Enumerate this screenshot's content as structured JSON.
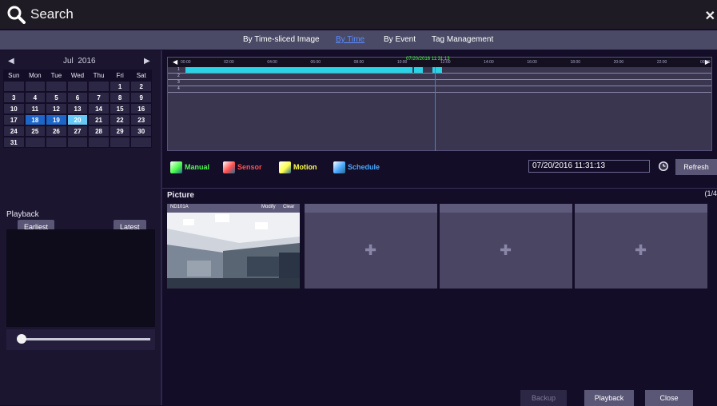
{
  "window": {
    "title": "Search",
    "close_icon": "close-icon"
  },
  "tabs": [
    {
      "label": "By Time-sliced Image",
      "active": false
    },
    {
      "label": "By Time",
      "active": true
    },
    {
      "label": "By Event",
      "active": false
    },
    {
      "label": "Tag Management",
      "active": false
    }
  ],
  "calendar": {
    "month": "Jul",
    "year": "2016",
    "weekdays": [
      "Sun",
      "Mon",
      "Tue",
      "Wed",
      "Thu",
      "Fri",
      "Sat"
    ],
    "weeks": [
      [
        "",
        "",
        "",
        "",
        "",
        "1",
        "2"
      ],
      [
        "3",
        "4",
        "5",
        "6",
        "7",
        "8",
        "9"
      ],
      [
        "10",
        "11",
        "12",
        "13",
        "14",
        "15",
        "16"
      ],
      [
        "17",
        "18",
        "19",
        "20",
        "21",
        "22",
        "23"
      ],
      [
        "24",
        "25",
        "26",
        "27",
        "28",
        "29",
        "30"
      ],
      [
        "31",
        "",
        "",
        "",
        "",
        "",
        ""
      ]
    ],
    "recorded_days": [
      "18",
      "19"
    ],
    "selected_day": "20",
    "earliest_label": "Earliest",
    "latest_label": "Latest"
  },
  "playback_panel": {
    "label": "Playback",
    "slider_position": 0.02
  },
  "timeline": {
    "cursor_time": "07/20/2016 11:31:13",
    "ticks": [
      "00:00",
      "02:00",
      "04:00",
      "06:00",
      "08:00",
      "10:00",
      "12:00",
      "14:00",
      "16:00",
      "18:00",
      "20:00",
      "22:00",
      "00:00"
    ],
    "channels": [
      "1",
      "2",
      "3",
      "4"
    ],
    "recordings": [
      {
        "channel": "1",
        "start_hour": 0.0,
        "end_hour": 10.5
      },
      {
        "channel": "1",
        "start_hour": 10.55,
        "end_hour": 10.95
      },
      {
        "channel": "1",
        "start_hour": 11.4,
        "end_hour": 11.85
      }
    ],
    "cursor_hour": 11.52
  },
  "legend": [
    {
      "label": "Manual",
      "color": "#4cff4c",
      "icon": "manual-record-icon"
    },
    {
      "label": "Sensor",
      "color": "#ff5050",
      "icon": "sensor-icon"
    },
    {
      "label": "Motion",
      "color": "#ffff4c",
      "icon": "motion-icon"
    },
    {
      "label": "Schedule",
      "color": "#4aa8ff",
      "icon": "schedule-icon"
    }
  ],
  "datetime": {
    "value": "07/20/2016 11:31:13"
  },
  "refresh_label": "Refresh",
  "picture": {
    "label": "Picture",
    "page_indicator": "(1/4",
    "slots": [
      {
        "name": "ND101A",
        "modify": "Modify",
        "clear": "Clear",
        "has_image": true
      },
      {
        "name": "",
        "has_image": false
      },
      {
        "name": "",
        "has_image": false
      },
      {
        "name": "",
        "has_image": false
      }
    ]
  },
  "buttons": {
    "backup": "Backup",
    "playback": "Playback",
    "close": "Close"
  },
  "colors": {
    "accent": "#1d66c9",
    "selected": "#66c8f5",
    "timeline_segment": "#28d3e6",
    "tab_active": "#5a8cff"
  }
}
